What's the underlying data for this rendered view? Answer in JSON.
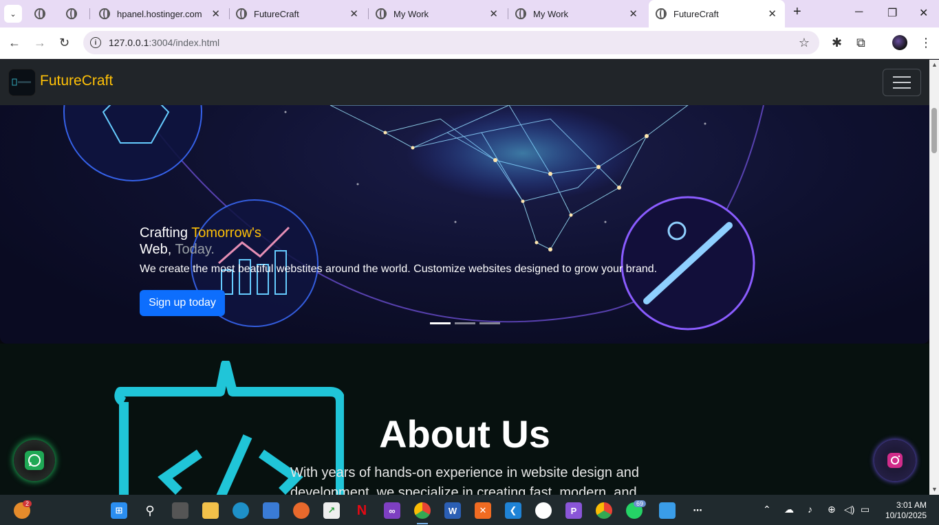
{
  "browser": {
    "tabs": [
      {
        "title": ""
      },
      {
        "title": ""
      },
      {
        "title": "hpanel.hostinger.com"
      },
      {
        "title": "FutureCraft"
      },
      {
        "title": "My Work"
      },
      {
        "title": "My Work"
      },
      {
        "title": "FutureCraft",
        "active": true
      }
    ],
    "url_host": "127.0.0.1",
    "url_rest": ":3004/index.html"
  },
  "site": {
    "brand": "FutureCraft",
    "hero": {
      "headline_part1": "Crafting ",
      "headline_gold": "Tomorrow's",
      "headline_part2": "Web, ",
      "headline_grey": "Today.",
      "subtext": "We create the most beatiful webstites around the world. Customize websites designed to grow your brand.",
      "cta_label": "Sign up today"
    },
    "about": {
      "title": "About Us",
      "body": "With years of hands-on experience in website design and development, we specialize in creating fast, modern, and"
    }
  },
  "taskbar": {
    "weather_badge": "2",
    "whatsapp_badge": "69",
    "time": "3:01 AM",
    "date": "10/10/2025"
  },
  "colors": {
    "brand_gold": "#ffc107",
    "cta_blue": "#0d6efd",
    "nav_dark": "#212529",
    "tab_strip": "#e8dbf5"
  }
}
